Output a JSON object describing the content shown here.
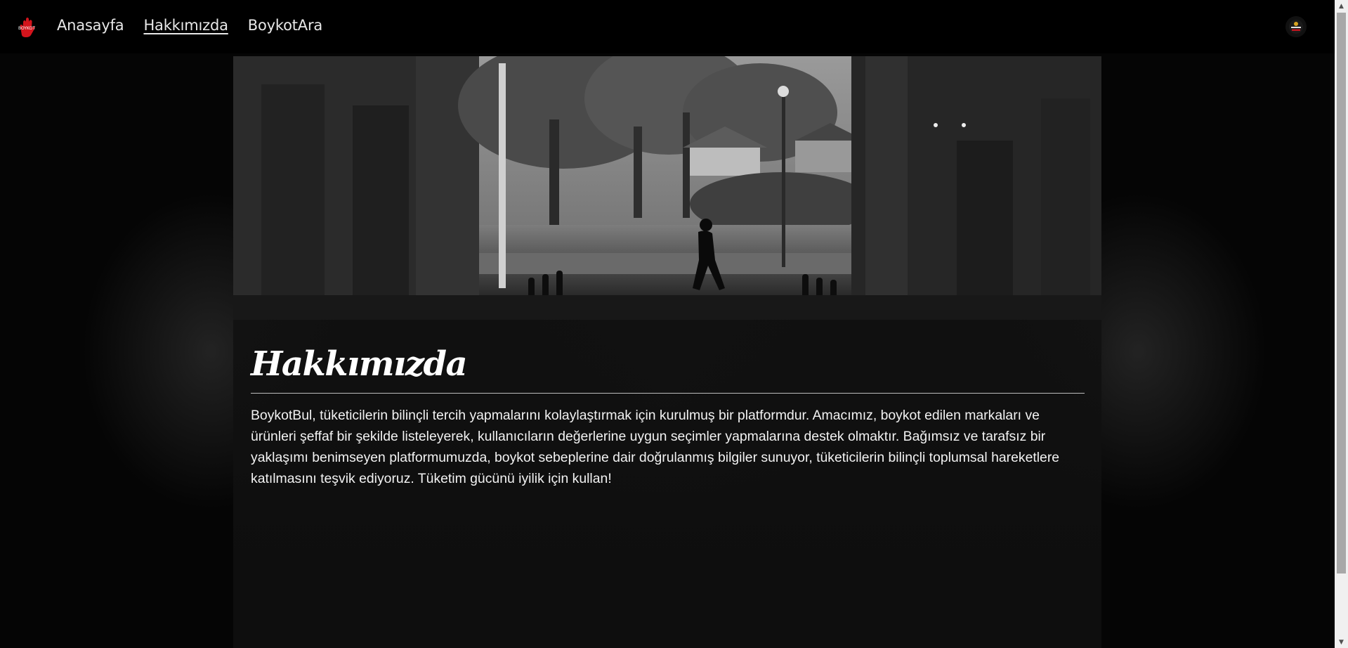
{
  "nav": {
    "logo_text": "BOYKOT",
    "links": [
      {
        "label": "Anasayfa",
        "active": false
      },
      {
        "label": "Hakkımızda",
        "active": true
      },
      {
        "label": "BoykotAra",
        "active": false
      }
    ]
  },
  "badge_icon": "brand-badge-icon",
  "about": {
    "title": "Hakkımızda",
    "text": "BoykotBul, tüketicilerin bilinçli tercih yapmalarını kolaylaştırmak için kurulmuş bir platformdur. Amacımız, boykot edilen markaları ve ürünleri şeffaf bir şekilde listeleyerek, kullanıcıların değerlerine uygun seçimler yapmalarına destek olmaktır. Bağımsız ve tarafsız bir yaklaşımı benimseyen platformumuzda, boykot sebeplerine dair doğrulanmış bilgiler sunuyor, tüketicilerin bilinçli toplumsal hareketlere katılmasını teşvik ediyoruz. Tüketim gücünü iyilik için kullan!"
  },
  "colors": {
    "accent": "#d4141c",
    "background": "#000000",
    "text": "#ffffff"
  }
}
